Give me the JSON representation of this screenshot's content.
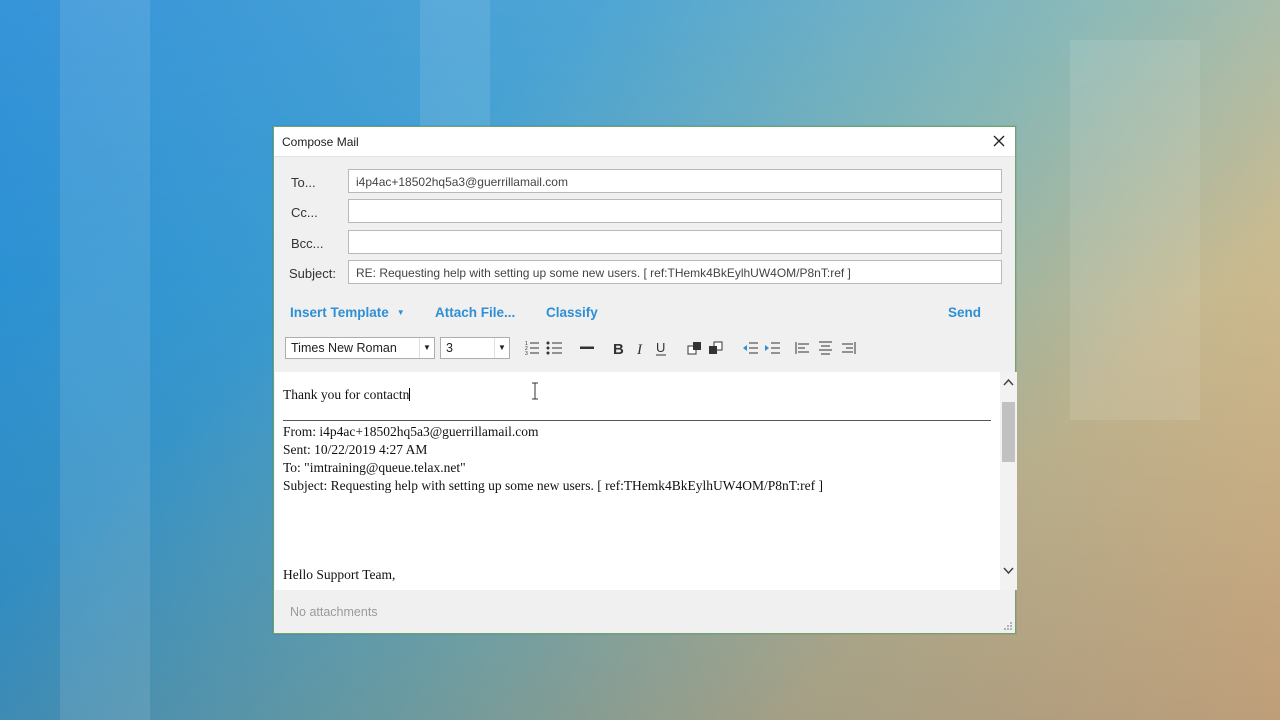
{
  "window": {
    "title": "Compose Mail"
  },
  "fields": {
    "to_label": "To...",
    "to_value": "i4p4ac+18502hq5a3@guerrillamail.com",
    "cc_label": "Cc...",
    "cc_value": "",
    "bcc_label": "Bcc...",
    "bcc_value": "",
    "subject_label": "Subject:",
    "subject_value": "RE: Requesting help with setting up some new users.  [ ref:THemk4BkEylhUW4OM/P8nT:ref ]"
  },
  "actions": {
    "insert_template": "Insert Template",
    "attach_file": "Attach File...",
    "classify": "Classify",
    "send": "Send"
  },
  "toolbar": {
    "font": "Times New Roman",
    "size": "3"
  },
  "body": {
    "typed": "Thank you for contactn",
    "from_line": "From: i4p4ac+18502hq5a3@guerrillamail.com",
    "sent_line": "Sent: 10/22/2019 4:27 AM",
    "to_line": "To: \"imtraining@queue.telax.net\"",
    "subject_line": "Subject: Requesting help with setting up some new users. [ ref:THemk4BkEylhUW4OM/P8nT:ref ]",
    "greeting": "Hello Support Team,"
  },
  "footer": {
    "attachments": "No attachments"
  },
  "colors": {
    "accent": "#2f8fd4",
    "border": "#6fa36f"
  }
}
